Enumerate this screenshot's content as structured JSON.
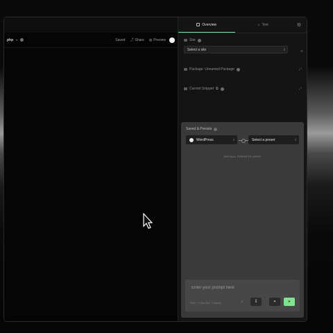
{
  "editor": {
    "language": "php",
    "toolbar": {
      "saved": "Saved",
      "share": "Share",
      "preview": "Preview"
    }
  },
  "sidebar": {
    "tabs": [
      {
        "label": "Overview",
        "active": true
      },
      {
        "label": "Test",
        "active": false
      }
    ],
    "site": {
      "label": "Site",
      "select_value": "Select a site"
    },
    "package": {
      "label": "Package: Unnamed Package"
    },
    "current_snippet": {
      "label": "Current Snippet"
    }
  },
  "presets": {
    "title": "Saved & Presets",
    "platform": "WordPress",
    "preset_select": "Select a preset",
    "install_label": "INSTALL PRESETS HERE"
  },
  "prompt": {
    "placeholder": "Enter your prompt here",
    "hint": "Shift + ⏎ New line · 0 tokens"
  },
  "colors": {
    "accent": "#7fe3a6",
    "send": "#7fe38f"
  }
}
